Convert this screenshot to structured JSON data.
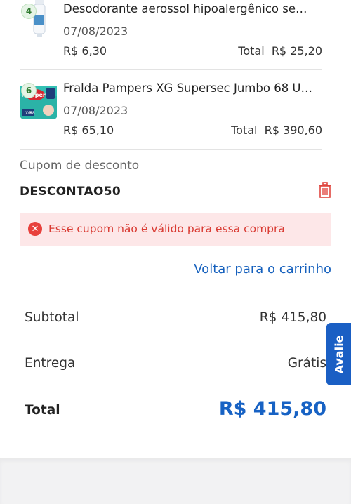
{
  "items": [
    {
      "quantity": "4",
      "name": "Desodorante aerossol hipoalergênico se…",
      "date": "07/08/2023",
      "unit_price": "R$ 6,30",
      "total_label": "Total",
      "total_value": "R$ 25,20",
      "thumb_icon": "deodorant-can-icon"
    },
    {
      "quantity": "6",
      "name": "Fralda Pampers XG Supersec Jumbo 68 U…",
      "date": "07/08/2023",
      "unit_price": "R$ 65,10",
      "total_label": "Total",
      "total_value": "R$ 390,60",
      "thumb_icon": "diaper-pack-icon",
      "pack_brand": "Pampers",
      "pack_size": "XG",
      "pack_count": "68"
    }
  ],
  "coupon": {
    "label": "Cupom de desconto",
    "code": "DESCONTAO50",
    "remove_icon": "trash-icon",
    "error_icon": "close-circle-icon",
    "error_message": "Esse cupom não é válido para essa compra"
  },
  "back_link": "Voltar para o carrinho",
  "summary": {
    "subtotal_label": "Subtotal",
    "subtotal_value": "R$ 415,80",
    "delivery_label": "Entrega",
    "delivery_value": "Grátis",
    "total_label": "Total",
    "total_value": "R$ 415,80"
  },
  "feedback_tab": "Avalie",
  "colors": {
    "accent_blue": "#1762c4",
    "error_red": "#e8413c",
    "error_bg": "#fde7e8",
    "link_blue": "#1560bd"
  }
}
